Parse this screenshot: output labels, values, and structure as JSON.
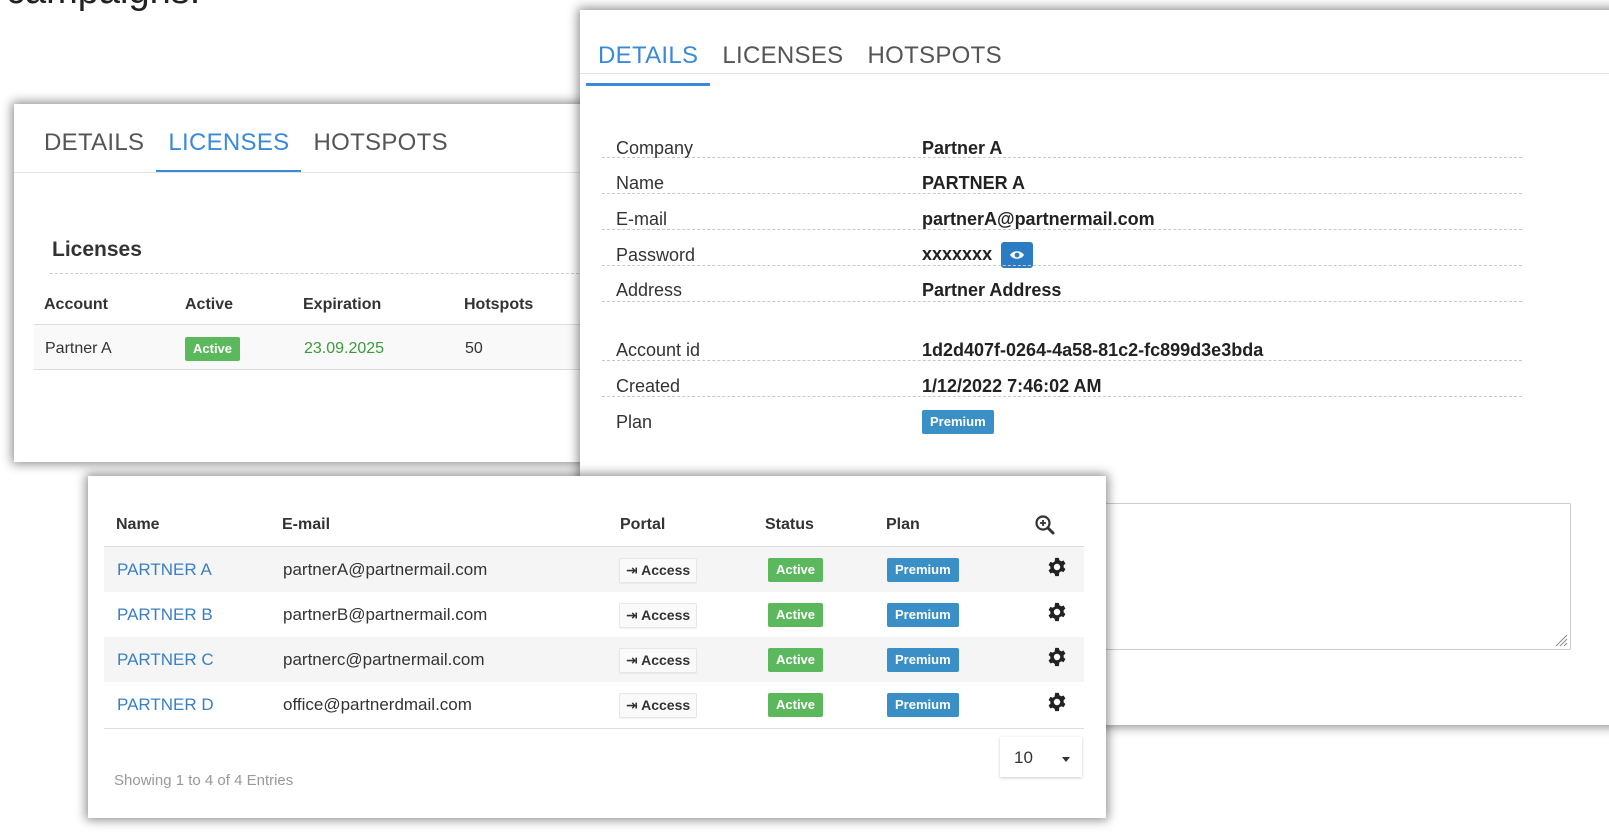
{
  "caption": "campaigns.",
  "licenses_card": {
    "tabs": [
      {
        "label": "DETAILS"
      },
      {
        "label": "LICENSES"
      },
      {
        "label": "HOTSPOTS"
      }
    ],
    "active_tab": "LICENSES",
    "heading": "Licenses",
    "columns": [
      "Account",
      "Active",
      "Expiration",
      "Hotspots"
    ],
    "row": {
      "account": "Partner A",
      "active": "Active",
      "expiration": "23.09.2025",
      "hotspots": "50"
    }
  },
  "details_card": {
    "tabs": [
      {
        "label": "DETAILS"
      },
      {
        "label": "LICENSES"
      },
      {
        "label": "HOTSPOTS"
      }
    ],
    "active_tab": "DETAILS",
    "fields": {
      "company": {
        "label": "Company",
        "value": "Partner A"
      },
      "name": {
        "label": "Name",
        "value": "PARTNER A"
      },
      "email": {
        "label": "E-mail",
        "value": "partnerA@partnermail.com"
      },
      "password": {
        "label": "Password",
        "value": "xxxxxxx"
      },
      "address": {
        "label": "Address",
        "value": "Partner Address"
      },
      "account_id": {
        "label": "Account id",
        "value": "1d2d407f-0264-4a58-81c2-fc899d3e3bda"
      },
      "created": {
        "label": "Created",
        "value": "1/12/2022 7:46:02 AM"
      },
      "plan": {
        "label": "Plan",
        "value": "Premium"
      }
    }
  },
  "partners_table": {
    "columns": {
      "name": "Name",
      "email": "E-mail",
      "portal": "Portal",
      "status": "Status",
      "plan": "Plan"
    },
    "rows": [
      {
        "name": "PARTNER A",
        "email": "partnerA@partnermail.com",
        "portal": "Access",
        "status": "Active",
        "plan": "Premium"
      },
      {
        "name": "PARTNER B",
        "email": "partnerB@partnermail.com",
        "portal": "Access",
        "status": "Active",
        "plan": "Premium"
      },
      {
        "name": "PARTNER C",
        "email": "partnerc@partnermail.com",
        "portal": "Access",
        "status": "Active",
        "plan": "Premium"
      },
      {
        "name": "PARTNER D",
        "email": "office@partnerdmail.com",
        "portal": "Access",
        "status": "Active",
        "plan": "Premium"
      }
    ],
    "page_size": "10",
    "footer": "Showing 1 to 4 of 4 Entries"
  },
  "icons": {
    "search": "zoom-in-icon",
    "gear": "gear-icon",
    "eye": "eye-icon",
    "login": "sign-in-icon",
    "caret": "caret-down-icon"
  },
  "colors": {
    "accent": "#3a8ad9",
    "status_green": "#5cb85c",
    "plan_blue": "#3a8fc7",
    "expiration_green": "#3c9a3c",
    "link": "#3a7fc1"
  }
}
